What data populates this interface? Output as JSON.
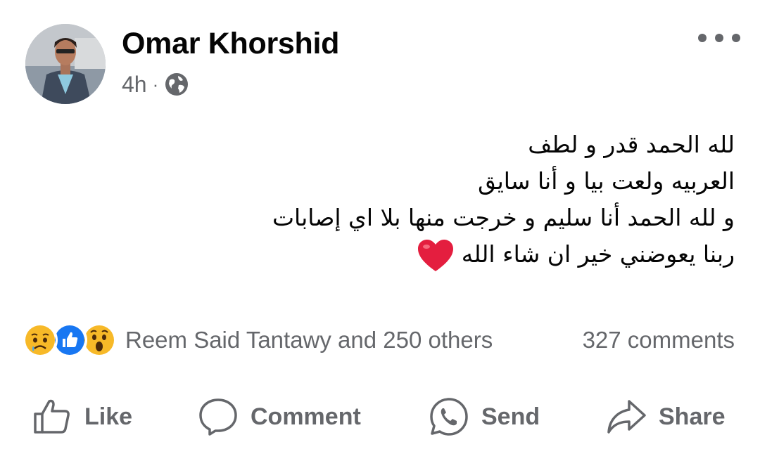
{
  "post": {
    "author": "Omar Khorshid",
    "time": "4h",
    "separator": "·",
    "privacy_icon": "globe-icon",
    "more_icon": "more-options-icon",
    "text_lines": [
      "لله الحمد قدر و لطف",
      "العربيه ولعت بيا و أنا سايق",
      "و لله الحمد أنا سليم و خرجت منها بلا اي إصابات",
      "ربنا يعوضني خير ان شاء الله"
    ],
    "end_emoji": "red-heart-emoji"
  },
  "reactions": {
    "icons": [
      "sad-reaction-icon",
      "like-reaction-icon",
      "wow-reaction-icon"
    ],
    "summary": "Reem Said Tantawy and 250 others",
    "comments": "327 comments"
  },
  "actions": {
    "like": "Like",
    "comment": "Comment",
    "send": "Send",
    "share": "Share"
  },
  "colors": {
    "text": "#050505",
    "secondary": "#65676b",
    "like_blue": "#1877f2",
    "heart_red": "#e41e3f",
    "reaction_yellow": "#f7b928"
  }
}
